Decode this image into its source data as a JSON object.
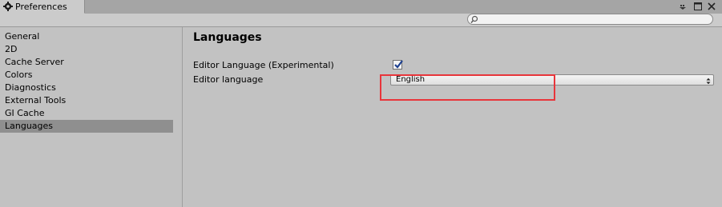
{
  "window": {
    "title": "Preferences"
  },
  "search": {
    "placeholder": ""
  },
  "sidebar": {
    "items": [
      {
        "label": "General"
      },
      {
        "label": "2D"
      },
      {
        "label": "Cache Server"
      },
      {
        "label": "Colors"
      },
      {
        "label": "Diagnostics"
      },
      {
        "label": "External Tools"
      },
      {
        "label": "GI Cache"
      },
      {
        "label": "Languages"
      }
    ],
    "selected": "Languages"
  },
  "main": {
    "title": "Languages",
    "editor_language_experimental": {
      "label": "Editor Language (Experimental)",
      "checked": true
    },
    "editor_language": {
      "label": "Editor language",
      "value": "English"
    }
  },
  "colors": {
    "highlight": "#e8353b",
    "selected_item_bg": "#8f8f8f"
  }
}
